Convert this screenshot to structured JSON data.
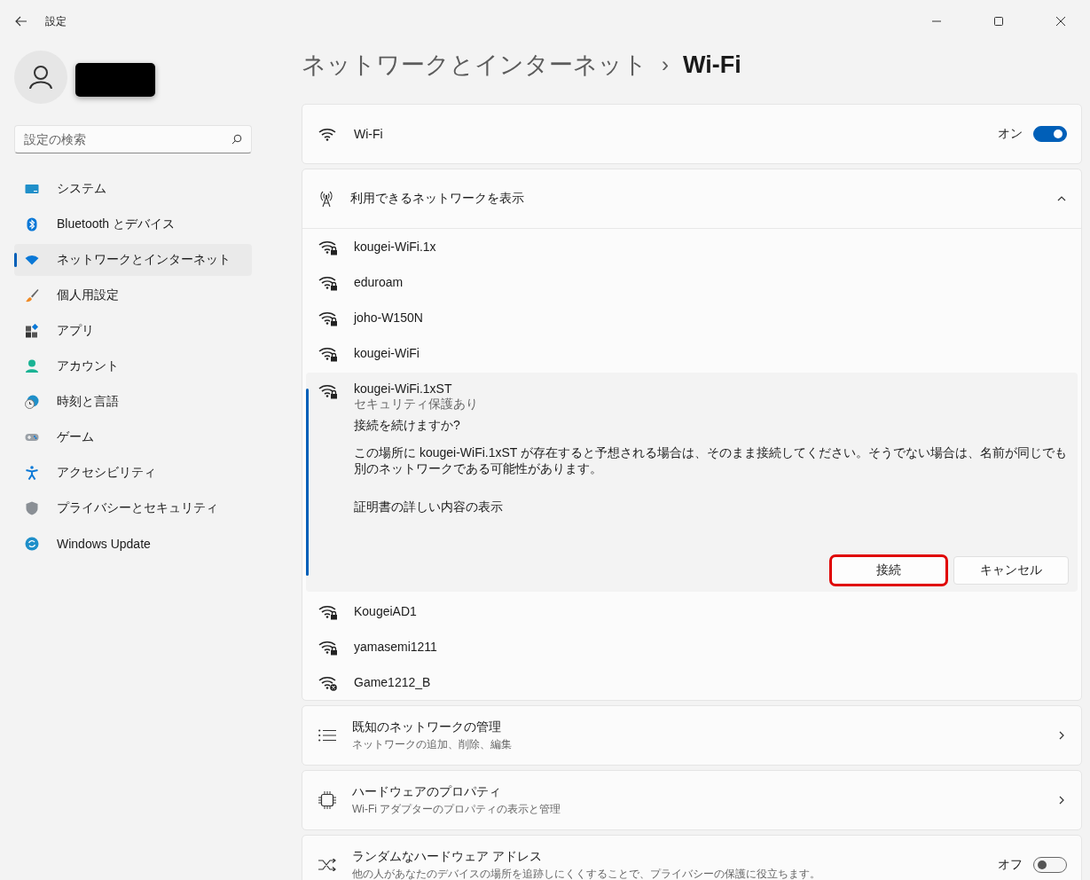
{
  "window": {
    "title": "設定"
  },
  "search": {
    "placeholder": "設定の検索"
  },
  "nav": [
    {
      "label": "システム",
      "selected": false
    },
    {
      "label": "Bluetooth とデバイス",
      "selected": false
    },
    {
      "label": "ネットワークとインターネット",
      "selected": true
    },
    {
      "label": "個人用設定",
      "selected": false
    },
    {
      "label": "アプリ",
      "selected": false
    },
    {
      "label": "アカウント",
      "selected": false
    },
    {
      "label": "時刻と言語",
      "selected": false
    },
    {
      "label": "ゲーム",
      "selected": false
    },
    {
      "label": "アクセシビリティ",
      "selected": false
    },
    {
      "label": "プライバシーとセキュリティ",
      "selected": false
    },
    {
      "label": "Windows Update",
      "selected": false
    }
  ],
  "breadcrumb": {
    "parent": "ネットワークとインターネット",
    "separator": "›",
    "current": "Wi-Fi"
  },
  "wifi": {
    "label": "Wi-Fi",
    "state_text": "オン",
    "on": true
  },
  "networks": {
    "header": "利用できるネットワークを表示",
    "expanded": true,
    "items": [
      {
        "name": "kougei-WiFi.1x",
        "kind": "secured",
        "expanded": false
      },
      {
        "name": "eduroam",
        "kind": "secured",
        "expanded": false
      },
      {
        "name": "joho-W150N",
        "kind": "secured",
        "expanded": false
      },
      {
        "name": "kougei-WiFi",
        "kind": "secured",
        "expanded": false
      },
      {
        "name": "kougei-WiFi.1xST",
        "kind": "secured",
        "expanded": true,
        "status": "セキュリティ保護あり",
        "question": "接続を続けますか?",
        "message": "この場所に kougei-WiFi.1xST が存在すると予想される場合は、そのまま接続してください。そうでない場合は、名前が同じでも別のネットワークである可能性があります。",
        "link": "証明書の詳しい内容の表示",
        "buttons": [
          {
            "label": "接続",
            "highlighted": true
          },
          {
            "label": "キャンセル",
            "highlighted": false
          }
        ]
      },
      {
        "name": "KougeiAD1",
        "kind": "secured",
        "expanded": false
      },
      {
        "name": "yamasemi1211",
        "kind": "secured",
        "expanded": false
      },
      {
        "name": "Game1212_B",
        "kind": "unavailable",
        "expanded": false
      }
    ]
  },
  "settings": [
    {
      "kind": "link",
      "title": "既知のネットワークの管理",
      "subtitle": "ネットワークの追加、削除、編集"
    },
    {
      "kind": "link",
      "title": "ハードウェアのプロパティ",
      "subtitle": "Wi-Fi アダプターのプロパティの表示と管理"
    },
    {
      "kind": "toggle",
      "title": "ランダムなハードウェア アドレス",
      "subtitle": "他の人があなたのデバイスの場所を追跡しにくくすることで、プライバシーの保護に役立ちます。",
      "state_text": "オフ",
      "on": false
    }
  ]
}
